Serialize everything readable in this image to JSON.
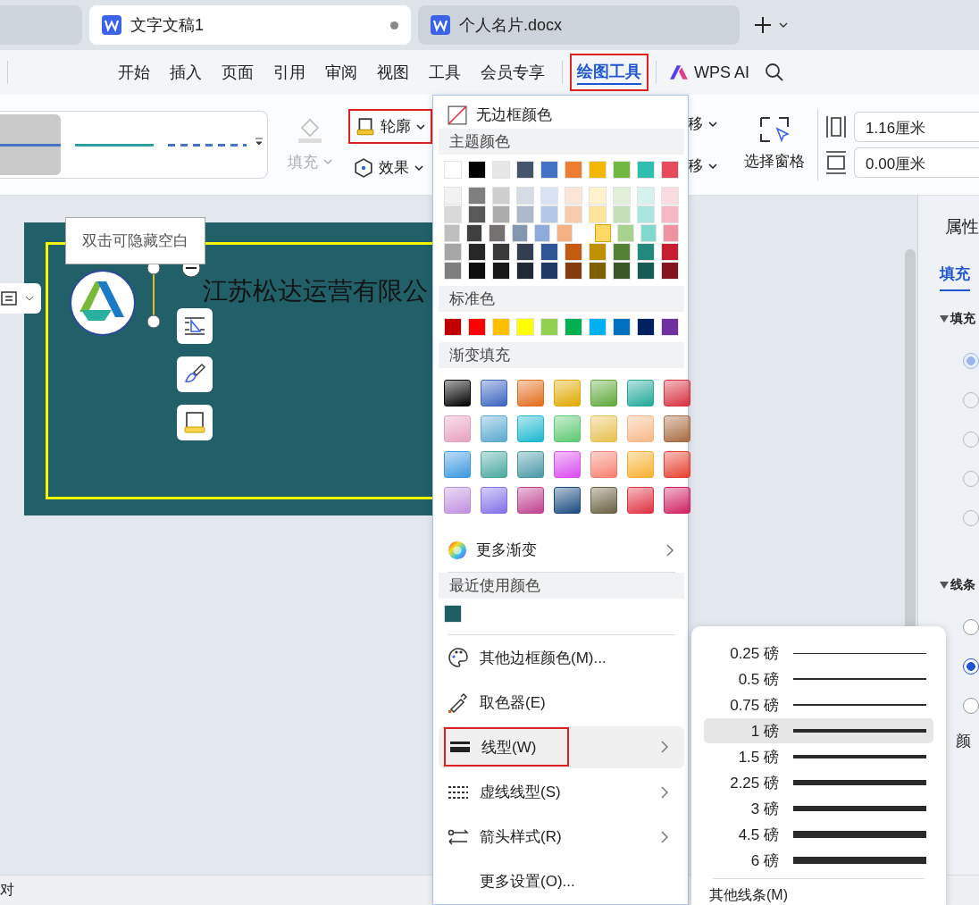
{
  "tabs": [
    {
      "label": "文字文稿1",
      "selected": true,
      "modified": true
    },
    {
      "label": "个人名片.docx",
      "selected": false,
      "modified": false
    }
  ],
  "menu": [
    {
      "label": "开始",
      "selected": false,
      "highlighted": false
    },
    {
      "label": "插入",
      "selected": false,
      "highlighted": false
    },
    {
      "label": "页面",
      "selected": false,
      "highlighted": false
    },
    {
      "label": "引用",
      "selected": false,
      "highlighted": false
    },
    {
      "label": "审阅",
      "selected": false,
      "highlighted": false
    },
    {
      "label": "视图",
      "selected": false,
      "highlighted": false
    },
    {
      "label": "工具",
      "selected": false,
      "highlighted": false
    },
    {
      "label": "会员专享",
      "selected": false,
      "highlighted": false
    },
    {
      "label": "绘图工具",
      "selected": true,
      "highlighted": true
    }
  ],
  "ai_label": "WPS AI",
  "gallery": [
    {
      "kind": "solid",
      "color": "#4472c4",
      "selected": true
    },
    {
      "kind": "solid",
      "color": "#2ea0a8",
      "selected": false
    },
    {
      "kind": "dashed",
      "color": "#4472c4",
      "selected": false
    }
  ],
  "ribbon": {
    "fill": {
      "label": "填充",
      "disabled": true
    },
    "outline": {
      "label": "轮廓",
      "highlighted": true
    },
    "effect": {
      "label": "效果"
    },
    "move_up": "移",
    "move_down": "移",
    "selection_pane": "选择窗格",
    "width": "1.16厘米",
    "height": "0.00厘米"
  },
  "document": {
    "tooltip": "双击可隐藏空白",
    "company": "江苏松达运营有限公"
  },
  "color_menu": {
    "no_border": "无边框颜色",
    "theme_heading": "主题颜色",
    "theme": [
      {
        "color": "#ffffff"
      },
      {
        "color": "#000000"
      },
      {
        "color": "#e7e6e6"
      },
      {
        "color": "#44546a"
      },
      {
        "color": "#4472c4"
      },
      {
        "color": "#ed7d31"
      },
      {
        "color": "#f2b800"
      },
      {
        "color": "#70b840"
      },
      {
        "color": "#2ebfb0"
      },
      {
        "color": "#e84c5c"
      }
    ],
    "shades": [
      {
        "color": "#f2f2f2",
        "selected": false
      },
      {
        "color": "#7f7f7f",
        "selected": false
      },
      {
        "color": "#d0cece",
        "selected": false
      },
      {
        "color": "#d6dce5",
        "selected": false
      },
      {
        "color": "#dae3f3",
        "selected": false
      },
      {
        "color": "#fbe5d6",
        "selected": false
      },
      {
        "color": "#fff2cc",
        "selected": false
      },
      {
        "color": "#e2f0d9",
        "selected": false
      },
      {
        "color": "#d5f2ef",
        "selected": false
      },
      {
        "color": "#fadbe0",
        "selected": false
      },
      {
        "color": "#d9d9d9",
        "selected": false
      },
      {
        "color": "#595959",
        "selected": false
      },
      {
        "color": "#aeabab",
        "selected": false
      },
      {
        "color": "#adb9ca",
        "selected": false
      },
      {
        "color": "#b4c7e7",
        "selected": false
      },
      {
        "color": "#f8cbad",
        "selected": false
      },
      {
        "color": "#ffe699",
        "selected": false
      },
      {
        "color": "#c5e0b4",
        "selected": false
      },
      {
        "color": "#abe5df",
        "selected": false
      },
      {
        "color": "#f5b7c1",
        "selected": false
      },
      {
        "color": "#bfbfbf",
        "selected": false
      },
      {
        "color": "#3f3f3f",
        "selected": false
      },
      {
        "color": "#757171",
        "selected": false
      },
      {
        "color": "#8497b0",
        "selected": false
      },
      {
        "color": "#8faadc",
        "selected": false
      },
      {
        "color": "#f4b183",
        "selected": false
      },
      {
        "color": "#ffd966",
        "selected": true
      },
      {
        "color": "#a9d18e",
        "selected": false
      },
      {
        "color": "#80d8cf",
        "selected": false
      },
      {
        "color": "#f092a2",
        "selected": false
      },
      {
        "color": "#a6a6a6",
        "selected": false
      },
      {
        "color": "#262626",
        "selected": false
      },
      {
        "color": "#3a3838",
        "selected": false
      },
      {
        "color": "#333f50",
        "selected": false
      },
      {
        "color": "#2f5597",
        "selected": false
      },
      {
        "color": "#c55a11",
        "selected": false
      },
      {
        "color": "#bf9000",
        "selected": false
      },
      {
        "color": "#548235",
        "selected": false
      },
      {
        "color": "#23897e",
        "selected": false
      },
      {
        "color": "#c81d30",
        "selected": false
      },
      {
        "color": "#7f7f7f",
        "selected": false
      },
      {
        "color": "#0d0d0d",
        "selected": false
      },
      {
        "color": "#171717",
        "selected": false
      },
      {
        "color": "#222a35",
        "selected": false
      },
      {
        "color": "#203864",
        "selected": false
      },
      {
        "color": "#843c0c",
        "selected": false
      },
      {
        "color": "#7f6000",
        "selected": false
      },
      {
        "color": "#385723",
        "selected": false
      },
      {
        "color": "#175c54",
        "selected": false
      },
      {
        "color": "#861320",
        "selected": false
      }
    ],
    "standard_heading": "标准色",
    "standard": [
      {
        "color": "#c00000"
      },
      {
        "color": "#ff0000"
      },
      {
        "color": "#ffc000"
      },
      {
        "color": "#ffff00"
      },
      {
        "color": "#92d050"
      },
      {
        "color": "#00b050"
      },
      {
        "color": "#00b0f0"
      },
      {
        "color": "#0070c0"
      },
      {
        "color": "#002060"
      },
      {
        "color": "#7030a0"
      }
    ],
    "gradient_heading": "渐变填充",
    "gradients": [
      {
        "color": "#000000"
      },
      {
        "color": "#3a63c0"
      },
      {
        "color": "#e36c1a"
      },
      {
        "color": "#e0a800"
      },
      {
        "color": "#5ea83a"
      },
      {
        "color": "#22a89a"
      },
      {
        "color": "#d8303f"
      },
      {
        "color": "#e8a0c0"
      },
      {
        "color": "#5aa8d0"
      },
      {
        "color": "#1cb8d0"
      },
      {
        "color": "#5cc870"
      },
      {
        "color": "#e8c050"
      },
      {
        "color": "#f8b888"
      },
      {
        "color": "#a86a40"
      },
      {
        "color": "#3a98e0"
      },
      {
        "color": "#4aa8a0"
      },
      {
        "color": "#4a98a8"
      },
      {
        "color": "#d84cf0"
      },
      {
        "color": "#f88070"
      },
      {
        "color": "#f8b030"
      },
      {
        "color": "#e84030"
      },
      {
        "color": "#c090e0"
      },
      {
        "color": "#8070e8"
      },
      {
        "color": "#c04090"
      },
      {
        "color": "#1a4a80"
      },
      {
        "color": "#6a6040"
      },
      {
        "color": "#e03040"
      },
      {
        "color": "#d02060"
      }
    ],
    "more_gradients": "更多渐变",
    "recent_heading": "最近使用颜色",
    "recent": [
      {
        "color": "#1f5f63"
      }
    ],
    "items": [
      {
        "kind": "palette",
        "label": "其他边框颜色(M)...",
        "submenu": false,
        "selected": false,
        "highlighted": false
      },
      {
        "kind": "picker",
        "label": "取色器(E)",
        "submenu": false,
        "selected": false,
        "highlighted": false
      },
      {
        "kind": "weight",
        "label": "线型(W)",
        "submenu": true,
        "selected": true,
        "highlighted": true
      },
      {
        "kind": "dash",
        "label": "虚线线型(S)",
        "submenu": true,
        "selected": false,
        "highlighted": false
      },
      {
        "kind": "arrow",
        "label": "箭头样式(R)",
        "submenu": true,
        "selected": false,
        "highlighted": false
      },
      {
        "kind": "plain",
        "label": "更多设置(O)...",
        "submenu": false,
        "selected": false,
        "highlighted": false
      }
    ]
  },
  "weights": [
    {
      "label": "0.25 磅",
      "selected": false
    },
    {
      "label": "0.5 磅",
      "selected": false
    },
    {
      "label": "0.75 磅",
      "selected": false
    },
    {
      "label": "1 磅",
      "selected": true
    },
    {
      "label": "1.5 磅",
      "selected": false
    },
    {
      "label": "2.25 磅",
      "selected": false
    },
    {
      "label": "3 磅",
      "selected": false
    },
    {
      "label": "4.5 磅",
      "selected": false
    },
    {
      "label": "6 磅",
      "selected": false
    }
  ],
  "other_lines": "其他线条(M)",
  "panel": {
    "title": "属性",
    "tab": "填充",
    "fill_heading": "填充",
    "fill_options": [
      {
        "selected": true
      },
      {
        "selected": false
      },
      {
        "selected": false
      },
      {
        "selected": false
      },
      {
        "selected": false
      }
    ],
    "line_heading": "线条",
    "line_options": [
      {
        "selected": false
      },
      {
        "selected": true
      },
      {
        "selected": false
      }
    ],
    "color_label": "颜"
  },
  "status": "对"
}
